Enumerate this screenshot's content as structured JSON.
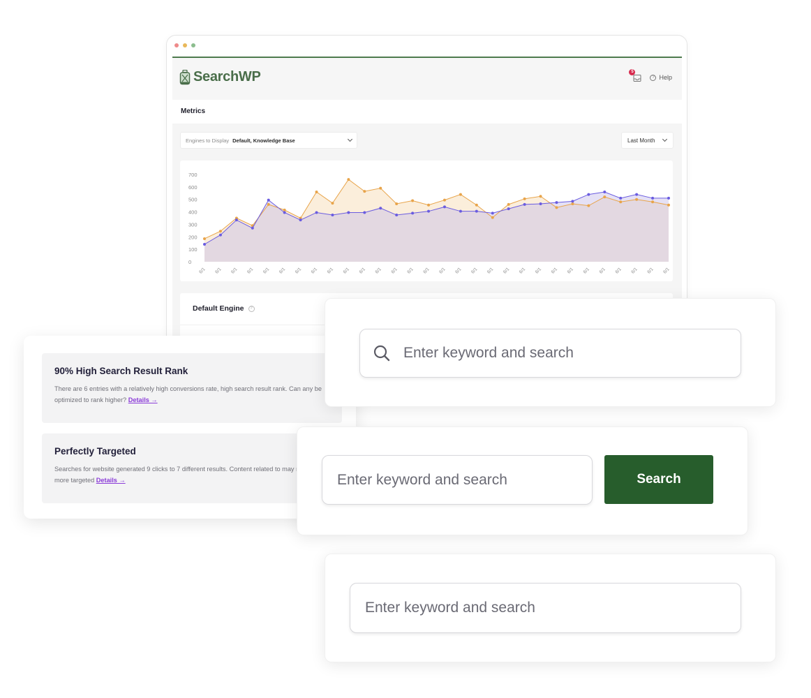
{
  "app": {
    "brand": "SearchWP",
    "notification_count": "5",
    "help_label": "Help",
    "section_title": "Metrics",
    "colors": {
      "brand_green": "#4a6e4a",
      "button_green": "#275d2c",
      "series_a": "#6a5ce0",
      "series_b": "#e8a44a",
      "link": "#8a3ad8",
      "badge": "#d72c4f"
    }
  },
  "filters": {
    "engines_label": "Engines to Display",
    "engines_value": "Default, Knowledge Base",
    "period_value": "Last Month"
  },
  "engine_card": {
    "title": "Default Engine"
  },
  "chart_data": {
    "type": "area",
    "title": "",
    "xlabel": "",
    "ylabel": "",
    "ylim": [
      0,
      700
    ],
    "yticks": [
      0,
      100,
      200,
      300,
      400,
      500,
      600,
      700
    ],
    "grid": false,
    "legend": "none",
    "x": [
      "6/1",
      "6/1",
      "6/1",
      "6/1",
      "6/1",
      "6/1",
      "6/1",
      "6/1",
      "6/1",
      "6/1",
      "6/1",
      "6/1",
      "6/1",
      "6/1",
      "6/1",
      "6/1",
      "6/1",
      "6/1",
      "6/1",
      "6/1",
      "6/1",
      "6/1",
      "6/1",
      "6/1",
      "6/1",
      "6/1",
      "6/1",
      "6/1",
      "6/1",
      "6/1"
    ],
    "series": [
      {
        "name": "Default",
        "color": "#e8a44a",
        "values": [
          185,
          245,
          350,
          290,
          460,
          415,
          350,
          560,
          470,
          660,
          565,
          590,
          465,
          490,
          455,
          495,
          540,
          455,
          355,
          460,
          505,
          525,
          435,
          465,
          450,
          520,
          480,
          500,
          480,
          455
        ]
      },
      {
        "name": "Knowledge Base",
        "color": "#6a5ce0",
        "values": [
          140,
          215,
          335,
          270,
          495,
          395,
          335,
          395,
          375,
          395,
          395,
          430,
          375,
          390,
          405,
          440,
          405,
          405,
          390,
          425,
          460,
          465,
          475,
          485,
          540,
          560,
          510,
          540,
          510,
          510
        ]
      }
    ]
  },
  "insights": [
    {
      "title": "90% High Search Result Rank",
      "text": "There are 6 entries with a relatively high conversions rate, high search result rank. Can any be optimized to rank higher?",
      "link": "Details →"
    },
    {
      "title": "Perfectly Targeted",
      "text": "Searches for website generated 9 clicks to 7 different results. Content related to may need to be more targeted",
      "link": "Details →"
    }
  ],
  "search_examples": {
    "placeholder": "Enter keyword and search",
    "button_label": "Search"
  }
}
